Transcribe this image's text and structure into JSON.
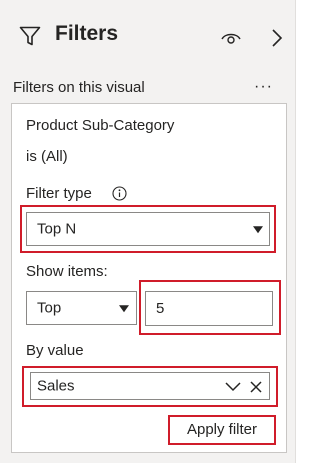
{
  "header": {
    "title": "Filters",
    "icons": [
      "filter-icon",
      "eye-icon",
      "chevron-right-icon"
    ]
  },
  "section": {
    "label": "Filters on this visual",
    "more_label": "···"
  },
  "card": {
    "field_name": "Product Sub-Category",
    "field_summary": "is (All)",
    "filter_type": {
      "label": "Filter type",
      "selected": "Top N",
      "info_icon": "info-icon"
    },
    "show_items": {
      "label": "Show items:",
      "direction": "Top",
      "count": "5"
    },
    "by_value": {
      "label": "By value",
      "field": "Sales"
    },
    "apply_label": "Apply filter"
  },
  "colors": {
    "highlight": "#d01c2a",
    "pane_bg": "#f3f2f1",
    "border": "#8a8886"
  }
}
